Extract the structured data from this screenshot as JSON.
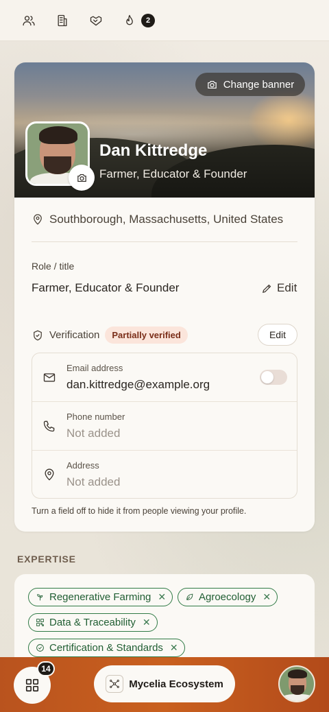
{
  "topbar": {
    "icons": [
      "people-icon",
      "building-icon",
      "handshake-icon",
      "flame-icon"
    ],
    "notification_count": "2"
  },
  "profile": {
    "change_banner_label": "Change banner",
    "name": "Dan Kittredge",
    "subtitle": "Farmer, Educator & Founder",
    "location": "Southborough, Massachusetts, United States",
    "role_label": "Role / title",
    "role_value": "Farmer, Educator & Founder",
    "role_edit_label": "Edit"
  },
  "verification": {
    "label": "Verification",
    "status": "Partially verified",
    "status_color": "#fbe5db",
    "edit_label": "Edit",
    "fields": [
      {
        "label": "Email address",
        "value": "dan.kittredge@example.org",
        "icon": "mail-icon",
        "visible_toggle": false
      },
      {
        "label": "Phone number",
        "value": "Not added",
        "icon": "phone-icon"
      },
      {
        "label": "Address",
        "value": "Not added",
        "icon": "map-pin-icon"
      }
    ],
    "hint": "Turn a field off to hide it from people viewing your profile."
  },
  "expertise": {
    "heading": "EXPERTISE",
    "chips": [
      {
        "label": "Regenerative Farming",
        "icon": "sprout-icon"
      },
      {
        "label": "Agroecology",
        "icon": "leaf-icon"
      },
      {
        "label": "Data & Traceability",
        "icon": "qr-code-icon"
      },
      {
        "label": "Certification & Standards",
        "icon": "check-circle-icon"
      }
    ],
    "accent_color": "#2f7a45"
  },
  "bottombar": {
    "apps_badge": "14",
    "ecosystem_label": "Mycelia Ecosystem",
    "bar_color": "#c9601f"
  }
}
